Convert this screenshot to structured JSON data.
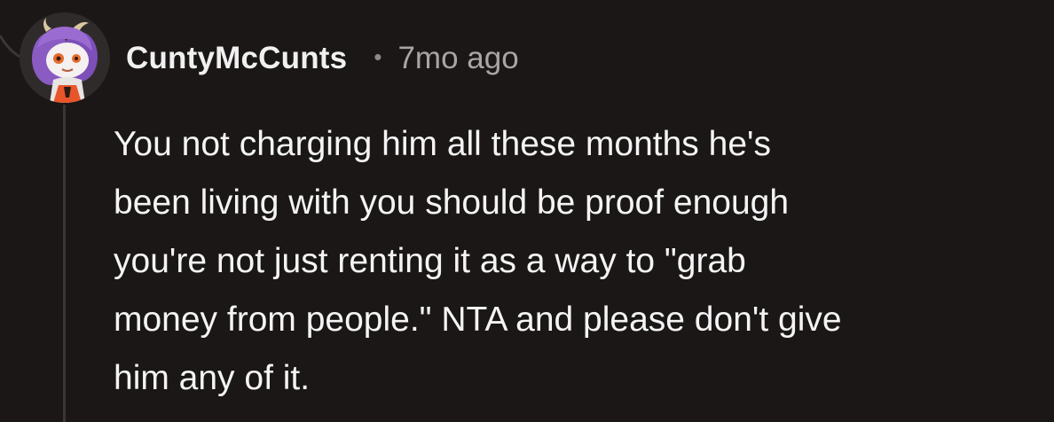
{
  "comment": {
    "author": {
      "username": "CuntyMcCunts",
      "avatar_icon": "snoo-avatar-icon"
    },
    "separator": "•",
    "timestamp": "7mo ago",
    "body_lines": [
      "You not charging him all these months he's",
      "been living with you should be proof enough",
      "you're not just renting it as a way to \"grab",
      "money from people.\" NTA and please don't give",
      "him any of it."
    ]
  },
  "colors": {
    "background": "#1a1716",
    "thread_line": "#3a3634",
    "username": "#f0f0f0",
    "timestamp": "#a8a5a3",
    "body_text": "#f4f4f4"
  }
}
